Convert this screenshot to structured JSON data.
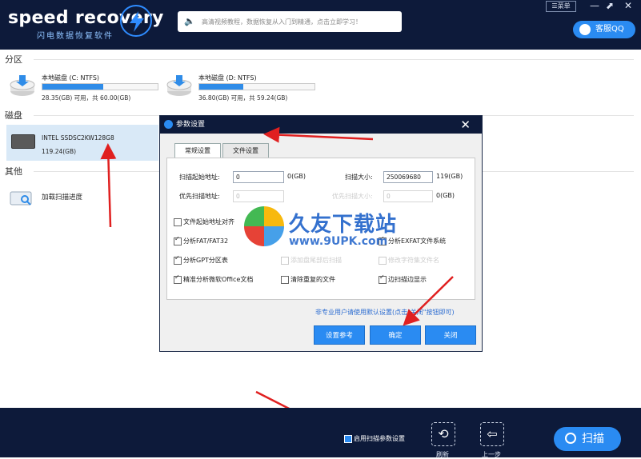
{
  "brand": {
    "name": "speed recovery",
    "subtitle": "闪电数据恢复软件"
  },
  "header": {
    "notice": "高清视频教程，数据恢复从入门到精通，点击立即学习！",
    "menu_label": "☰菜单",
    "qq_label": "客服QQ"
  },
  "sections": {
    "partition": "分区",
    "disk": "磁盘",
    "other": "其他"
  },
  "drives": [
    {
      "name": "本地磁盘 (C: NTFS)",
      "size": "28.35(GB) 可用，共 60.00(GB)",
      "used_fraction": 0.53
    },
    {
      "name": "本地磁盘 (D: NTFS)",
      "size": "36.80(GB) 可用，共 59.24(GB)",
      "used_fraction": 0.38
    }
  ],
  "disk": {
    "name": "INTEL SSDSC2KW128G8",
    "size": "119.24(GB)"
  },
  "other": {
    "scan_progress": "加载扫描进度"
  },
  "dialog": {
    "title": "参数设置",
    "tabs": [
      "常规设置",
      "文件设置"
    ],
    "scan_start_label": "扫描起始地址:",
    "scan_start_value": "0",
    "scan_start_unit": "0(GB)",
    "scan_size_label": "扫描大小:",
    "scan_size_value": "250069680",
    "scan_size_unit": "119(GB)",
    "priority_label": "优先扫描地址:",
    "priority_value": "0",
    "priority_size_label": "优先扫描大小:",
    "priority_size_value": "0",
    "priority_size_unit": "0(GB)",
    "checkboxes": {
      "file_start": "文件起始地址对齐",
      "fat": "分析FAT/FAT32",
      "exfat": "分析EXFAT文件系统",
      "gpt": "分析GPT分区表",
      "after_disk": "添加盘尾部后扫描",
      "filename": "修改字符集文件名",
      "office": "精准分析微软Office文档",
      "dedupe": "清除重复的文件",
      "edge": "边扫描边显示"
    },
    "hint": "非专业用户请使用默认设置(点击\"关闭\"按钮即可)",
    "btn_ref": "设置参考",
    "btn_ok": "确定",
    "btn_close": "关闭"
  },
  "watermark": {
    "text": "久友下载站",
    "url": "www.9UPK.com"
  },
  "footer": {
    "enable_label": "启用扫描参数设置",
    "refresh": "刷新",
    "back": "上一步",
    "scan": "扫描"
  },
  "colors": {
    "header_bg": "#0d1a3a",
    "accent": "#2a8bf2",
    "selection": "#d9e9f7"
  }
}
